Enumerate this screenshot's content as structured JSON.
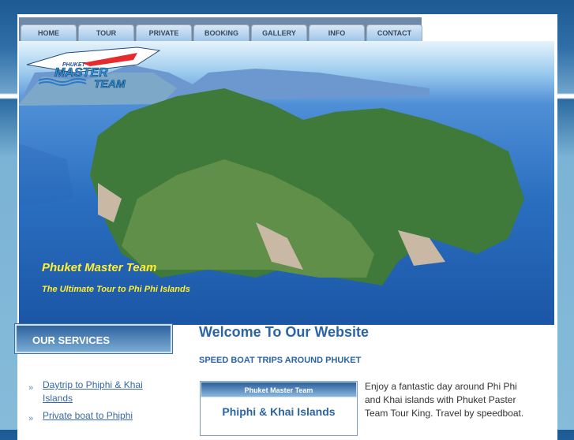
{
  "nav": [
    "HOME",
    "TOUR",
    "PRIVATE",
    "BOOKING",
    "GALLERY",
    "INFO",
    "CONTACT"
  ],
  "logo": {
    "line1": "PHUKET",
    "line2": "MASTER",
    "line3": "TEAM"
  },
  "hero": {
    "title": "Phuket Master Team",
    "subtitle": "The Ultimate Tour to Phi Phi Islands"
  },
  "sidebar": {
    "heading": "OUR SERVICES",
    "items": [
      "Daytrip to Phiphi & Khai Islands",
      "Private boat to Phiphi"
    ]
  },
  "main": {
    "title": "Welcome To Our Website",
    "subtitle": "SPEED BOAT TRIPS AROUND PHUKET",
    "box": {
      "header": "Phuket Master Team",
      "title": "Phiphi & Khai Islands"
    },
    "intro": "Enjoy a fantastic day around Phi Phi and Khai islands with Phuket Paster Team Tour King. Travel by speedboat."
  }
}
